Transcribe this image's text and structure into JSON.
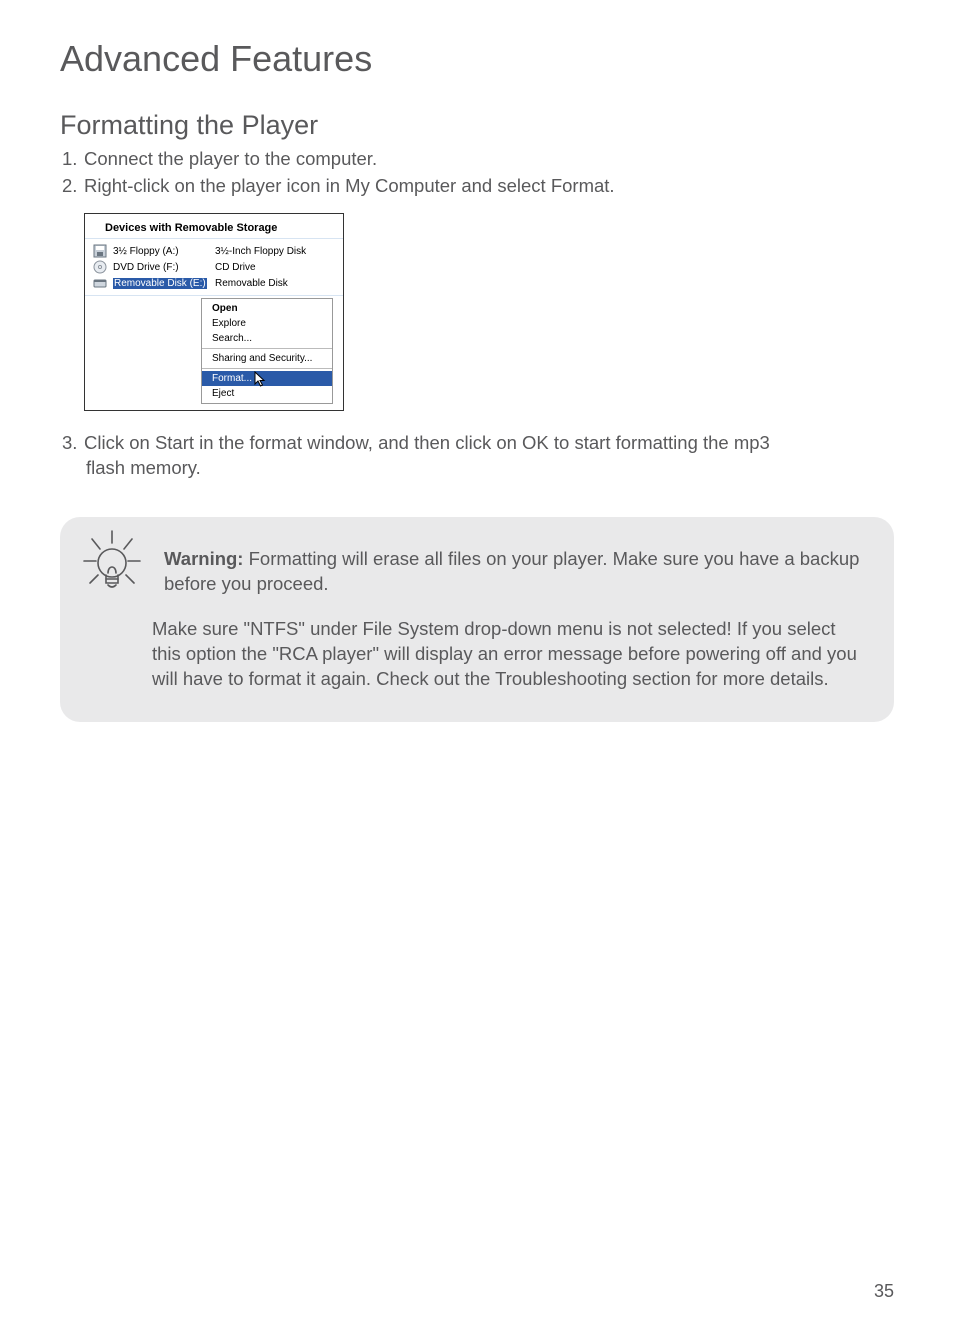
{
  "page": {
    "number": "35",
    "h1": "Advanced Features",
    "h2": "Formatting the Player"
  },
  "steps": {
    "s1_num": "1.",
    "s1_text": "Connect the player to the computer.",
    "s2_num": "2.",
    "s2_text": "Right-click on the player icon in My Computer and select Format.",
    "s3_num": "3.",
    "s3_text": "Click on Start in the format window, and then click on OK to start formatting the mp3",
    "s3_cont": "flash memory."
  },
  "win": {
    "heading": "Devices with Removable Storage",
    "rows": [
      {
        "name": "3½ Floppy (A:)",
        "type": "3½-Inch Floppy Disk"
      },
      {
        "name": "DVD Drive (F:)",
        "type": "CD Drive"
      },
      {
        "name": "Removable Disk (E:)",
        "type": "Removable Disk"
      }
    ],
    "menu": {
      "open": "Open",
      "explore": "Explore",
      "search": "Search...",
      "sharing": "Sharing and Security...",
      "format": "Format...",
      "eject": "Eject"
    }
  },
  "callout": {
    "warning_label": "Warning:",
    "warning_text": " Formatting will erase all files on your player. Make sure you have a backup before you proceed.",
    "note": "Make sure \"NTFS\" under File System drop-down menu is not selected! If you select this option the \"RCA player\" will display an error message before powering off and you will have to format it again. Check out the Troubleshooting section for more details."
  }
}
